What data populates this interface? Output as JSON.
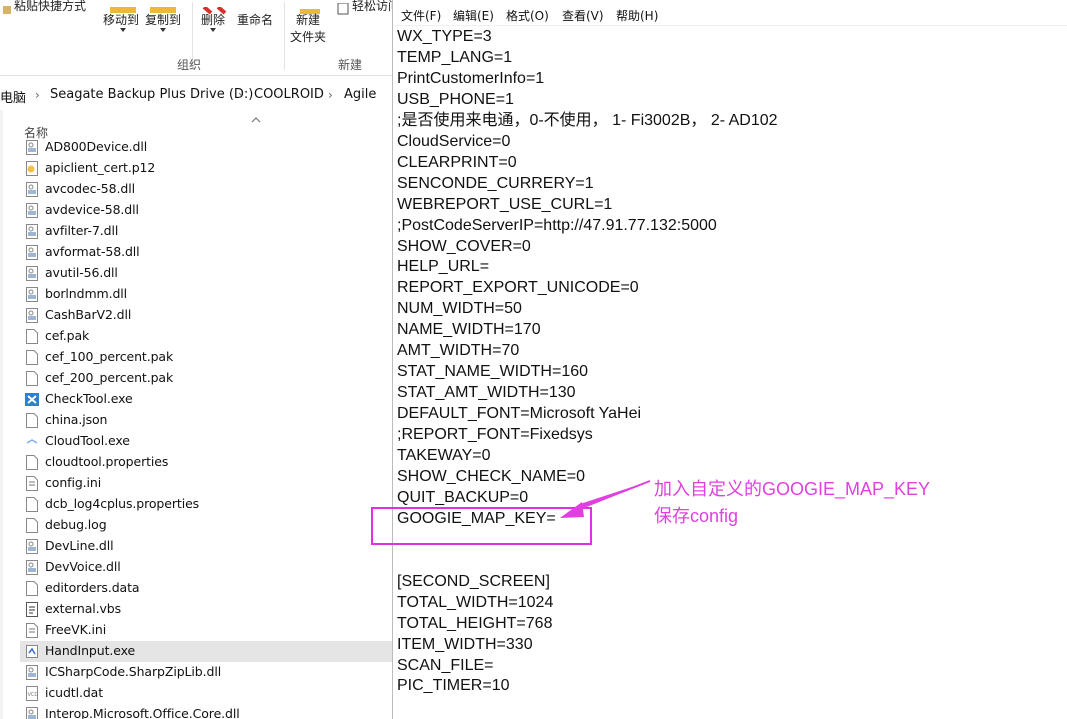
{
  "explorer": {
    "ribbon": {
      "paste_shortcut": "粘贴快捷方式",
      "move_to": "移动到",
      "copy_to": "复制到",
      "delete": "删除",
      "rename": "重命名",
      "new_folder_line1": "新建",
      "new_folder_line2": "文件夹",
      "easy_access": "轻松访问",
      "group_organize": "组织",
      "group_new": "新建"
    },
    "breadcrumb": [
      "电脑",
      "Seagate Backup Plus Drive (D:)",
      "COOLROID",
      "Agile"
    ],
    "column_name": "名称",
    "files": [
      {
        "name": "AD800Device.dll",
        "icon": "dll-icon"
      },
      {
        "name": "apiclient_cert.p12",
        "icon": "certificate-icon"
      },
      {
        "name": "avcodec-58.dll",
        "icon": "dll-icon"
      },
      {
        "name": "avdevice-58.dll",
        "icon": "dll-icon"
      },
      {
        "name": "avfilter-7.dll",
        "icon": "dll-icon"
      },
      {
        "name": "avformat-58.dll",
        "icon": "dll-icon"
      },
      {
        "name": "avutil-56.dll",
        "icon": "dll-icon"
      },
      {
        "name": "borlndmm.dll",
        "icon": "dll-icon"
      },
      {
        "name": "CashBarV2.dll",
        "icon": "dll-icon"
      },
      {
        "name": "cef.pak",
        "icon": "file-icon"
      },
      {
        "name": "cef_100_percent.pak",
        "icon": "file-icon"
      },
      {
        "name": "cef_200_percent.pak",
        "icon": "file-icon"
      },
      {
        "name": "CheckTool.exe",
        "icon": "tool-exe-icon"
      },
      {
        "name": "china.json",
        "icon": "file-icon"
      },
      {
        "name": "CloudTool.exe",
        "icon": "cloud-exe-icon"
      },
      {
        "name": "cloudtool.properties",
        "icon": "file-icon"
      },
      {
        "name": "config.ini",
        "icon": "ini-icon"
      },
      {
        "name": "dcb_log4cplus.properties",
        "icon": "file-icon"
      },
      {
        "name": "debug.log",
        "icon": "file-icon"
      },
      {
        "name": "DevLine.dll",
        "icon": "dll-icon"
      },
      {
        "name": "DevVoice.dll",
        "icon": "dll-icon"
      },
      {
        "name": "editorders.data",
        "icon": "file-icon"
      },
      {
        "name": "external.vbs",
        "icon": "script-icon"
      },
      {
        "name": "FreeVK.ini",
        "icon": "ini-icon"
      },
      {
        "name": "HandInput.exe",
        "icon": "exe-icon",
        "selected": true
      },
      {
        "name": "ICSharpCode.SharpZipLib.dll",
        "icon": "dll-icon"
      },
      {
        "name": "icudtl.dat",
        "icon": "dat-icon"
      },
      {
        "name": "Interop.Microsoft.Office.Core.dll",
        "icon": "dll-icon"
      }
    ]
  },
  "notepad": {
    "menu": [
      "文件(F)",
      "编辑(E)",
      "格式(O)",
      "查看(V)",
      "帮助(H)"
    ],
    "lines": [
      "WX_TYPE=3",
      "TEMP_LANG=1",
      "PrintCustomerInfo=1",
      "USB_PHONE=1",
      ";是否使用来电通，0-不使用， 1- Fi3002B， 2- AD102",
      "CloudService=0",
      "CLEARPRINT=0",
      "SENCONDE_CURRERY=1",
      "WEBREPORT_USE_CURL=1",
      ";PostCodeServerIP=http://47.91.77.132:5000",
      "SHOW_COVER=0",
      "HELP_URL=",
      "REPORT_EXPORT_UNICODE=0",
      "NUM_WIDTH=50",
      "NAME_WIDTH=170",
      "AMT_WIDTH=70",
      "STAT_NAME_WIDTH=160",
      "STAT_AMT_WIDTH=130",
      "DEFAULT_FONT=Microsoft YaHei",
      ";REPORT_FONT=Fixedsys",
      "TAKEWAY=0",
      "SHOW_CHECK_NAME=0",
      "QUIT_BACKUP=0",
      "GOOGIE_MAP_KEY=",
      "",
      "",
      "[SECOND_SCREEN]",
      "TOTAL_WIDTH=1024",
      "TOTAL_HEIGHT=768",
      "ITEM_WIDTH=330",
      "SCAN_FILE=",
      "PIC_TIMER=10"
    ]
  },
  "annotation": {
    "line1": "加入自定义的GOOGIE_MAP_KEY",
    "line2": "保存config",
    "color": "#e040e0"
  }
}
